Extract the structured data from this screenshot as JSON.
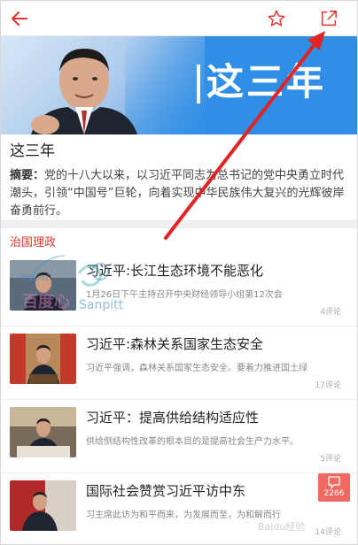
{
  "toolbar": {
    "back_icon": "arrow-left-icon",
    "favorite_icon": "star-outline-icon",
    "share_icon": "external-share-icon",
    "accent": "#e2342d"
  },
  "banner": {
    "title": "这三年",
    "color": "#2f8ee6"
  },
  "article": {
    "title": "这三年",
    "summary_label": "摘要：",
    "summary_text": "党的十八大以来，以习近平同志为总书记的党中央勇立时代潮头，引领“中国号”巨轮，向着实现中华民族伟大复兴的光辉彼岸奋勇前行。"
  },
  "section": {
    "label": "治国理政"
  },
  "watermark": {
    "text_cn": "百度心",
    "text_en": "Sanpitt",
    "arc_text": "ONLINE"
  },
  "news": [
    {
      "title": "习近平:长江生态环境不能恶化",
      "desc": "1月26日下午主持召开中央财经领导小组第12次会",
      "comments": "4评论"
    },
    {
      "title": "习近平:森林关系国家生态安全",
      "desc": "习近平强调，森林关系国家生态安全。要着力推进国土绿",
      "comments": "17评论"
    },
    {
      "title": "习近平：提高供给结构适应性",
      "desc": "供给侧结构性改革的根本目的是提高社会生产力水平。",
      "comments": "5评论"
    },
    {
      "title": "国际社会赞赏习近平访中东",
      "desc": "习主席此访为和平而来，为发展而至，为和解而行",
      "comments": "14评论"
    }
  ],
  "comment_fab": {
    "icon": "comment-bubble-icon",
    "count": "2266"
  },
  "footer_watermark": "Baidu经验"
}
